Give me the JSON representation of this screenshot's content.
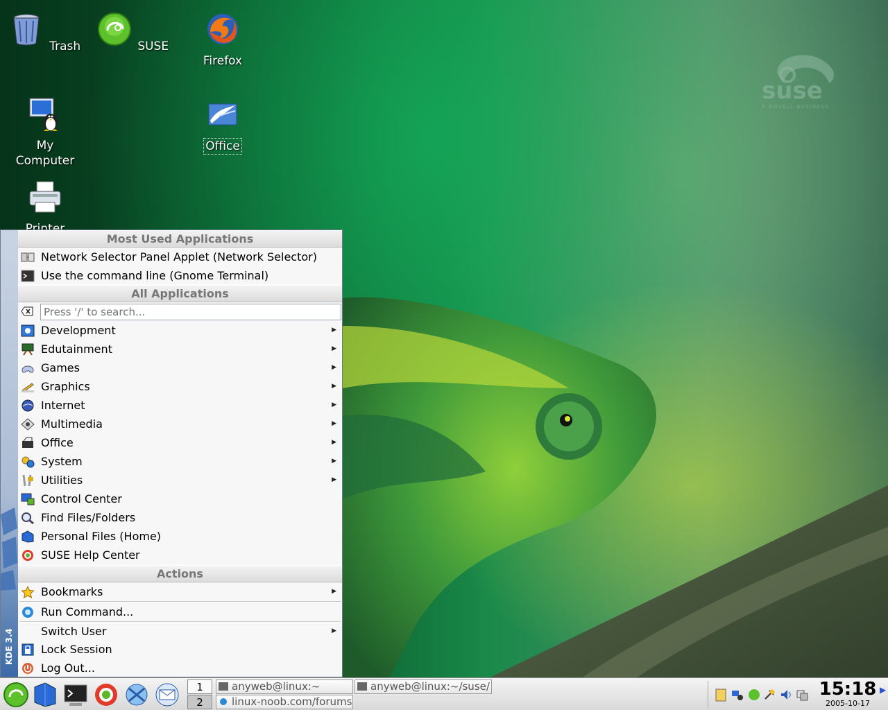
{
  "desktop": {
    "icons": [
      {
        "label": "Trash"
      },
      {
        "label": "SUSE"
      },
      {
        "label": "Firefox"
      },
      {
        "label": "My Computer"
      },
      {
        "label": "Office"
      },
      {
        "label": "Printer"
      }
    ],
    "watermark": {
      "brand": "suse",
      "tagline": "A NOVELL BUSINESS"
    }
  },
  "kmenu": {
    "side_brand": "KDE 3.4",
    "most_used_title": "Most Used Applications",
    "most_used": [
      {
        "label": "Network Selector Panel Applet (Network Selector)",
        "icon": "network-selector-icon"
      },
      {
        "label": "Use the command line (Gnome Terminal)",
        "icon": "terminal-icon"
      }
    ],
    "all_apps_title": "All Applications",
    "search_placeholder": "Press '/' to search...",
    "categories": [
      {
        "label": "Development",
        "icon": "development-icon",
        "submenu": true
      },
      {
        "label": "Edutainment",
        "icon": "edutainment-icon",
        "submenu": true
      },
      {
        "label": "Games",
        "icon": "games-icon",
        "submenu": true
      },
      {
        "label": "Graphics",
        "icon": "graphics-icon",
        "submenu": true
      },
      {
        "label": "Internet",
        "icon": "internet-icon",
        "submenu": true
      },
      {
        "label": "Multimedia",
        "icon": "multimedia-icon",
        "submenu": true
      },
      {
        "label": "Office",
        "icon": "office-icon",
        "submenu": true
      },
      {
        "label": "System",
        "icon": "system-icon",
        "submenu": true
      },
      {
        "label": "Utilities",
        "icon": "utilities-icon",
        "submenu": true
      },
      {
        "label": "Control Center",
        "icon": "control-center-icon",
        "submenu": false
      },
      {
        "label": "Find Files/Folders",
        "icon": "find-icon",
        "submenu": false
      },
      {
        "label": "Personal Files (Home)",
        "icon": "home-icon",
        "submenu": false
      },
      {
        "label": "SUSE Help Center",
        "icon": "help-icon",
        "submenu": false
      }
    ],
    "actions_title": "Actions",
    "actions": [
      {
        "label": "Bookmarks",
        "icon": "bookmarks-icon"
      },
      {
        "label": "Run Command...",
        "icon": "run-command-icon"
      },
      {
        "label": "Switch User",
        "icon": ""
      },
      {
        "label": "Lock Session",
        "icon": "lock-icon"
      },
      {
        "label": "Log Out...",
        "icon": "logout-icon"
      }
    ]
  },
  "panel": {
    "pager": [
      "1",
      "2"
    ],
    "tasks": [
      {
        "label": "anyweb@linux:~"
      },
      {
        "label": "anyweb@linux:~/suse/"
      },
      {
        "label": "linux-noob.com/forums"
      }
    ],
    "clock": {
      "time": "15:18",
      "date": "2005-10-17"
    }
  },
  "colors": {
    "menu_bg": "#f7f7f7",
    "accent": "#3b6aa6",
    "suse_green": "#6ec43a"
  }
}
